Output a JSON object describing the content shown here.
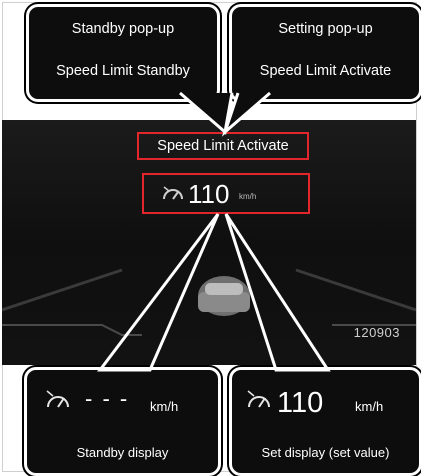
{
  "popups": {
    "standby": {
      "title": "Standby pop-up",
      "message": "Speed Limit Standby"
    },
    "setting": {
      "title": "Setting pop-up",
      "message": "Speed Limit Activate"
    }
  },
  "dashboard": {
    "active_message": "Speed Limit Activate",
    "speed_value": "110",
    "speed_unit": "km/h",
    "odometer": "120903",
    "highlight_color": "#e3262b"
  },
  "panels": {
    "standby": {
      "value": "- - -",
      "unit": "km/h",
      "caption": "Standby display"
    },
    "set": {
      "value": "110",
      "unit": "km/h",
      "caption": "Set display (set value)"
    }
  },
  "icons": [
    "speed-limiter-gauge-icon"
  ]
}
